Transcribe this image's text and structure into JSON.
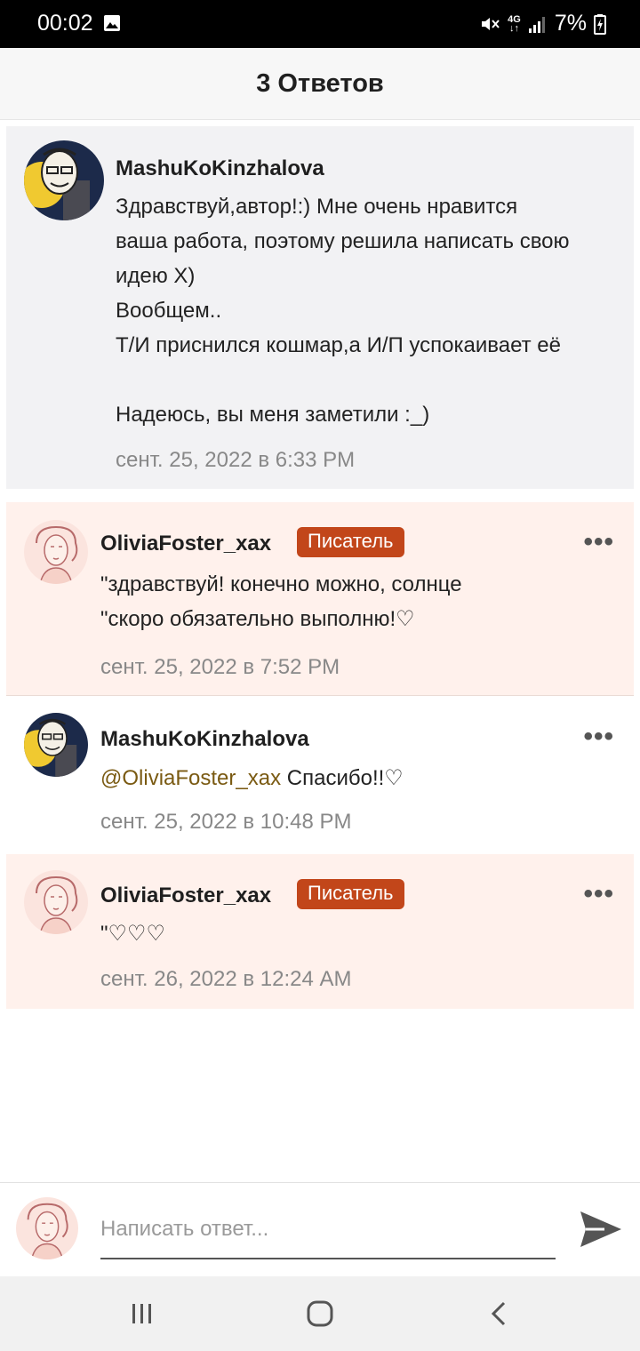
{
  "status": {
    "time": "00:02",
    "net_top": "4G",
    "net_bottom": "↓↑",
    "battery": "7%"
  },
  "header": {
    "title": "3 Ответов"
  },
  "main_comment": {
    "username": "MashuKoKinzhalova",
    "text": "Здравствуй,автор!:) Мне очень нравится\nваша работа, поэтому решила написать свою\nидею Х)\nВообщем..\nТ/И приснился кошмар,а И/П успокаивает её\n\nНадеюсь,  вы меня заметили :_)",
    "timestamp": "сент. 25, 2022 в 6:33 PM"
  },
  "replies": [
    {
      "username": "OliviaFoster_xax",
      "badge": "Писатель",
      "text": "\"здравствуй! конечно можно, солнце\n\"скоро обязательно выполню!♡",
      "timestamp": "сент. 25, 2022 в 7:52 PM",
      "more": "•••"
    },
    {
      "username": "MashuKoKinzhalova",
      "mention": "@OliviaFoster_xax",
      "text": " Спасибо!!♡",
      "timestamp": "сент. 25, 2022 в 10:48 PM",
      "more": "•••"
    },
    {
      "username": "OliviaFoster_xax",
      "badge": "Писатель",
      "text": "\"♡♡♡",
      "timestamp": "сент. 26, 2022 в 12:24 AM",
      "more": "•••"
    }
  ],
  "reply_bar": {
    "placeholder": "Написать ответ..."
  },
  "colors": {
    "badge": "#c2461a",
    "reply_bg": "#fff1ec",
    "main_bg": "#f2f2f4",
    "mention": "#7a5a12"
  },
  "icons": [
    "image-icon",
    "mute-icon",
    "signal-icon",
    "battery-icon",
    "more-icon",
    "send-icon",
    "recents-icon",
    "home-icon",
    "back-icon"
  ]
}
